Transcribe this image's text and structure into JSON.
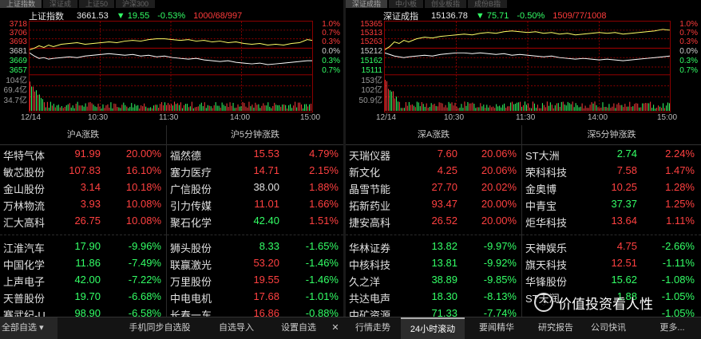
{
  "left_chart": {
    "tabs": [
      "上证指数",
      "深证成",
      "上证50",
      "沪深300"
    ],
    "name": "上证指数",
    "value": "3661.53",
    "change": "▼ 19.55",
    "pct": "-0.53%",
    "counts": "1000/68/997",
    "yaxis_left": [
      "3718",
      "3706",
      "3693",
      "3681",
      "3669",
      "3657",
      "104亿",
      "69.4亿",
      "34.7亿"
    ],
    "yaxis_right": [
      "1.0%",
      "0.7%",
      "0.3%",
      "0.0%",
      "0.3%",
      "0.7%"
    ],
    "times": [
      "12/14",
      "10:30",
      "11:30",
      "14:00",
      "15:00"
    ]
  },
  "right_chart": {
    "tabs": [
      "深证成指",
      "中小板",
      "创业板指",
      "成份B指"
    ],
    "name": "深证成指",
    "value": "15136.78",
    "change": "▼ 75.71",
    "pct": "-0.50%",
    "counts": "1509/77/1008",
    "yaxis_left": [
      "15365",
      "15313",
      "15263",
      "15212",
      "15162",
      "15111",
      "153亿",
      "102亿",
      "50.9亿"
    ],
    "yaxis_right": [
      "1.0%",
      "0.7%",
      "0.3%",
      "0.0%",
      "0.3%",
      "0.7%"
    ],
    "times": [
      "12/14",
      "10:30",
      "11:30",
      "14:00",
      "15:00"
    ]
  },
  "lists": {
    "sh_a": {
      "title": "沪A涨跌",
      "rows": [
        {
          "name": "华特气体",
          "price": "91.99",
          "pct": "20.00%",
          "dir": "up"
        },
        {
          "name": "敏芯股份",
          "price": "107.83",
          "pct": "16.10%",
          "dir": "up"
        },
        {
          "name": "金山股份",
          "price": "3.14",
          "pct": "10.18%",
          "dir": "up"
        },
        {
          "name": "万林物流",
          "price": "3.93",
          "pct": "10.08%",
          "dir": "up"
        },
        {
          "name": "汇大高科",
          "price": "26.75",
          "pct": "10.08%",
          "dir": "up"
        },
        {
          "name": "江淮汽车",
          "price": "17.90",
          "pct": "-9.96%",
          "dir": "dn"
        },
        {
          "name": "中国化学",
          "price": "11.86",
          "pct": "-7.49%",
          "dir": "dn"
        },
        {
          "name": "上声电子",
          "price": "42.00",
          "pct": "-7.22%",
          "dir": "dn"
        },
        {
          "name": "天普股份",
          "price": "19.70",
          "pct": "-6.68%",
          "dir": "dn"
        },
        {
          "name": "赛武纪-U",
          "price": "98.90",
          "pct": "-6.58%",
          "dir": "dn"
        }
      ]
    },
    "sh_5m": {
      "title": "沪5分钟涨跌",
      "rows": [
        {
          "name": "福然德",
          "price": "15.53",
          "pct": "4.79%",
          "dir": "up"
        },
        {
          "name": "塞力医疗",
          "price": "14.71",
          "pct": "2.15%",
          "dir": "up"
        },
        {
          "name": "广信股份",
          "price": "38.00",
          "pct": "1.88%",
          "dir": "flat"
        },
        {
          "name": "引力传媒",
          "price": "11.01",
          "pct": "1.66%",
          "dir": "up"
        },
        {
          "name": "聚石化学",
          "price": "42.40",
          "pct": "1.51%",
          "dir": "dnp"
        },
        {
          "name": "狮头股份",
          "price": "8.33",
          "pct": "-1.65%",
          "dir": "dn"
        },
        {
          "name": "联赢激光",
          "price": "53.20",
          "pct": "-1.46%",
          "dir": "upn"
        },
        {
          "name": "万里股份",
          "price": "19.55",
          "pct": "-1.46%",
          "dir": "upn"
        },
        {
          "name": "中电电机",
          "price": "17.68",
          "pct": "-1.01%",
          "dir": "upn"
        },
        {
          "name": "长春一东",
          "price": "16.86",
          "pct": "-0.88%",
          "dir": "upn"
        }
      ]
    },
    "sz_a": {
      "title": "深A涨跌",
      "rows": [
        {
          "name": "天瑞仪器",
          "price": "7.60",
          "pct": "20.06%",
          "dir": "up"
        },
        {
          "name": "新文化",
          "price": "4.25",
          "pct": "20.06%",
          "dir": "up"
        },
        {
          "name": "晶雪节能",
          "price": "27.70",
          "pct": "20.02%",
          "dir": "up"
        },
        {
          "name": "拓新药业",
          "price": "93.47",
          "pct": "20.00%",
          "dir": "up"
        },
        {
          "name": "捷安高科",
          "price": "26.52",
          "pct": "20.00%",
          "dir": "up"
        },
        {
          "name": "华林证券",
          "price": "13.82",
          "pct": "-9.97%",
          "dir": "dn"
        },
        {
          "name": "中核科技",
          "price": "13.81",
          "pct": "-9.92%",
          "dir": "dn"
        },
        {
          "name": "久之洋",
          "price": "38.89",
          "pct": "-9.85%",
          "dir": "dn"
        },
        {
          "name": "共达电声",
          "price": "18.30",
          "pct": "-8.13%",
          "dir": "dnc"
        },
        {
          "name": "中矿资源",
          "price": "71.33",
          "pct": "-7.74%",
          "dir": "dn"
        }
      ]
    },
    "sz_5m": {
      "title": "深5分钟涨跌",
      "rows": [
        {
          "name": "ST大洲",
          "price": "2.74",
          "pct": "2.24%",
          "dir": "dnp"
        },
        {
          "name": "荣科科技",
          "price": "7.58",
          "pct": "1.47%",
          "dir": "up"
        },
        {
          "name": "金奥博",
          "price": "10.25",
          "pct": "1.28%",
          "dir": "up"
        },
        {
          "name": "中青宝",
          "price": "37.37",
          "pct": "1.25%",
          "dir": "dnp"
        },
        {
          "name": "炬华科技",
          "price": "13.64",
          "pct": "1.11%",
          "dir": "up"
        },
        {
          "name": "天神娱乐",
          "price": "4.75",
          "pct": "-2.66%",
          "dir": "upn"
        },
        {
          "name": "旗天科技",
          "price": "12.51",
          "pct": "-1.11%",
          "dir": "upn"
        },
        {
          "name": "华锋股份",
          "price": "15.62",
          "pct": "-1.08%",
          "dir": "dn"
        },
        {
          "name": "ST天润",
          "price": "1.88",
          "pct": "-1.05%",
          "dir": "dn"
        },
        {
          "name": "",
          "price": "",
          "pct": "-1.05%",
          "dir": "dn"
        }
      ]
    }
  },
  "bottombar": {
    "left": [
      "全部自选",
      "手机同步自选股",
      "自选导入",
      "设置自选"
    ],
    "right": [
      "行情走势",
      "24小时滚动",
      "要闻精华",
      "研究报告",
      "公司快讯",
      "更多..."
    ]
  },
  "watermark": "价值投资看人性",
  "colors": {
    "up": "#ff4040",
    "down": "#33ff66",
    "price_line": "#ffff66",
    "avg_line": "#ffffff",
    "grid": "#8b0000"
  }
}
